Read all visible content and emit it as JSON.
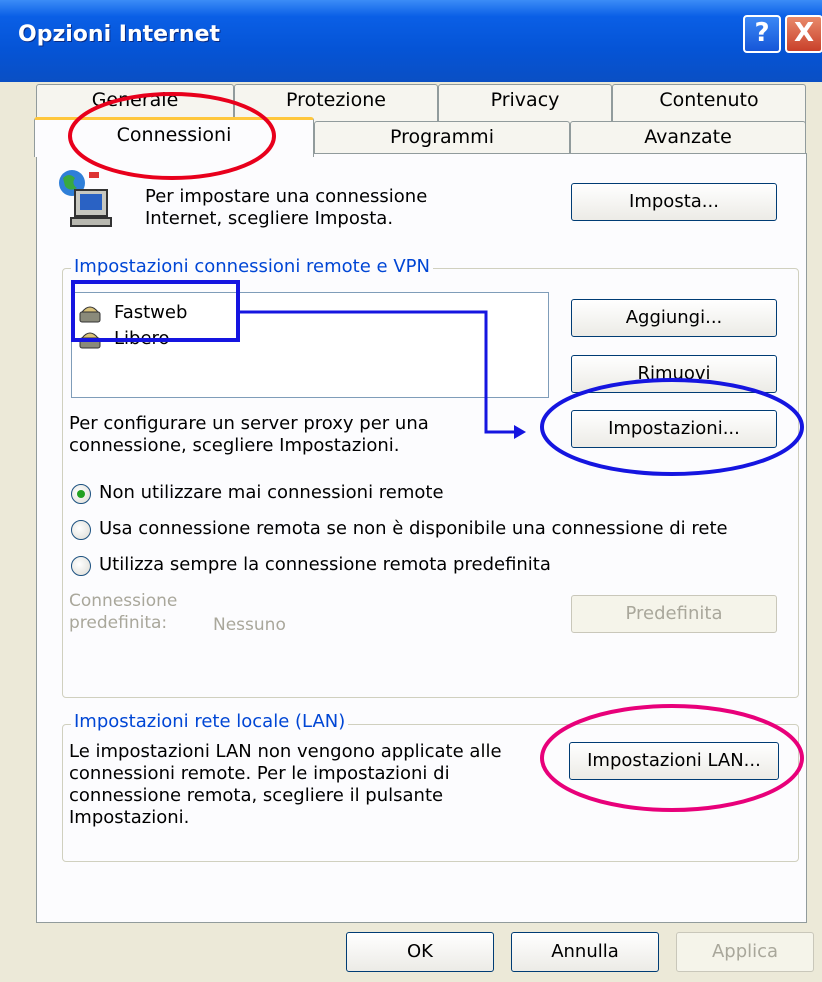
{
  "window": {
    "title": "Opzioni Internet"
  },
  "titlebar": {
    "help_label": "?",
    "close_label": "X"
  },
  "tabs": {
    "row1": [
      "Generale",
      "Protezione",
      "Privacy",
      "Contenuto"
    ],
    "row2": [
      "Connessioni",
      "Programmi",
      "Avanzate"
    ],
    "active": "Connessioni"
  },
  "setup": {
    "text_line1": "Per impostare una connessione",
    "text_line2": "Internet, scegliere Imposta.",
    "button": "Imposta...",
    "icon": "network-computer-icon"
  },
  "remote_group": {
    "legend": "Impostazioni connessioni remote e VPN",
    "connections": [
      {
        "name": "Fastweb",
        "icon": "dialup-connection-icon"
      },
      {
        "name": "Libero",
        "icon": "dialup-connection-icon"
      }
    ],
    "add_button": "Aggiungi...",
    "remove_button": "Rimuovi",
    "settings_button": "Impostazioni...",
    "proxy_text_line1": "Per configurare un server proxy per una",
    "proxy_text_line2": "connessione, scegliere Impostazioni.",
    "options": [
      {
        "label": "Non utilizzare mai connessioni remote",
        "checked": true
      },
      {
        "label": "Usa connessione remota se non è disponibile una connessione di rete",
        "checked": false
      },
      {
        "label": "Utilizza sempre la connessione remota predefinita",
        "checked": false
      }
    ],
    "default_label_line1": "Connessione",
    "default_label_line2": "predefinita:",
    "default_value": "Nessuno",
    "default_button": "Predefinita"
  },
  "lan_group": {
    "legend": "Impostazioni rete locale (LAN)",
    "text_lines": [
      "Le impostazioni LAN non vengono applicate alle",
      "connessioni remote. Per le impostazioni di",
      "connessione remota, scegliere il pulsante",
      "Impostazioni."
    ],
    "button": "Impostazioni LAN..."
  },
  "footer": {
    "ok": "OK",
    "cancel": "Annulla",
    "apply": "Applica"
  },
  "colors": {
    "titlebar": "#0554d6",
    "annotation_red": "#e8001c",
    "annotation_blue": "#1515e0",
    "annotation_magenta": "#e8007a"
  }
}
